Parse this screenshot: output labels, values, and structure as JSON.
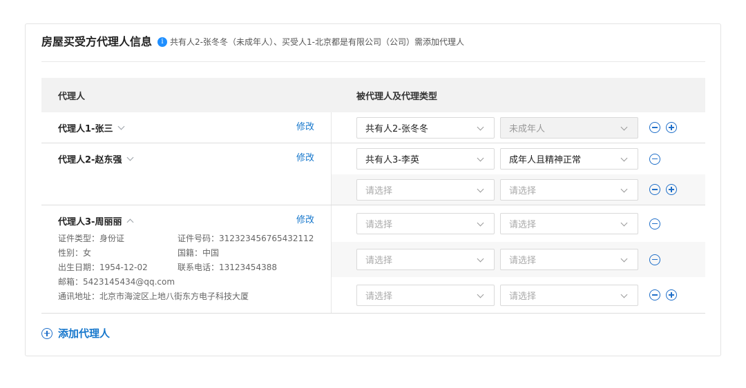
{
  "card": {
    "title": "房屋买受方代理人信息",
    "info_icon": "info-icon",
    "notice": "共有人2-张冬冬（未成年人）、买受人1-北京都是有限公司（公司）需添加代理人"
  },
  "table": {
    "col_agent": "代理人",
    "col_principal": "被代理人及代理类型"
  },
  "agents": [
    {
      "name": "代理人1-张三",
      "expanded": false,
      "modify_label": "修改",
      "rows": [
        {
          "principal": "共有人2-张冬冬",
          "principal_placeholder": false,
          "type": "未成年人",
          "type_disabled": true,
          "ops": [
            "minus",
            "plus"
          ],
          "shade": false
        }
      ]
    },
    {
      "name": "代理人2-赵东强",
      "expanded": false,
      "modify_label": "修改",
      "rows": [
        {
          "principal": "共有人3-李英",
          "principal_placeholder": false,
          "type": "成年人且精神正常",
          "type_disabled": false,
          "ops": [
            "minus"
          ],
          "shade": false
        },
        {
          "principal": "请选择",
          "principal_placeholder": true,
          "type": "请选择",
          "type_placeholder": true,
          "ops": [
            "minus",
            "plus"
          ],
          "shade": true
        }
      ]
    },
    {
      "name": "代理人3-周丽丽",
      "expanded": true,
      "modify_label": "修改",
      "details": {
        "id_type": "证件类型：身份证",
        "id_number": "证件号码：312323456765432112",
        "gender": "性别：女",
        "nationality": "国籍：中国",
        "birth": "出生日期：1954-12-02",
        "phone": "联系电话：13123454388",
        "email": "邮箱：5423145434@qq.com",
        "address": "通讯地址：北京市海淀区上地八街东方电子科技大厦"
      },
      "rows": [
        {
          "principal": "请选择",
          "principal_placeholder": true,
          "type": "请选择",
          "type_placeholder": true,
          "ops": [
            "minus"
          ],
          "shade": false
        },
        {
          "principal": "请选择",
          "principal_placeholder": true,
          "type": "请选择",
          "type_placeholder": true,
          "ops": [
            "minus"
          ],
          "shade": true
        },
        {
          "principal": "请选择",
          "principal_placeholder": true,
          "type": "请选择",
          "type_placeholder": true,
          "ops": [
            "minus",
            "plus"
          ],
          "shade": false
        }
      ]
    }
  ],
  "add_agent": {
    "label": "添加代理人",
    "icon": "plus-circle-icon"
  },
  "colors": {
    "accent": "#1677cc",
    "info": "#1f8fff",
    "header_bg": "#f2f2f2",
    "shade_bg": "#f7f7f7"
  }
}
